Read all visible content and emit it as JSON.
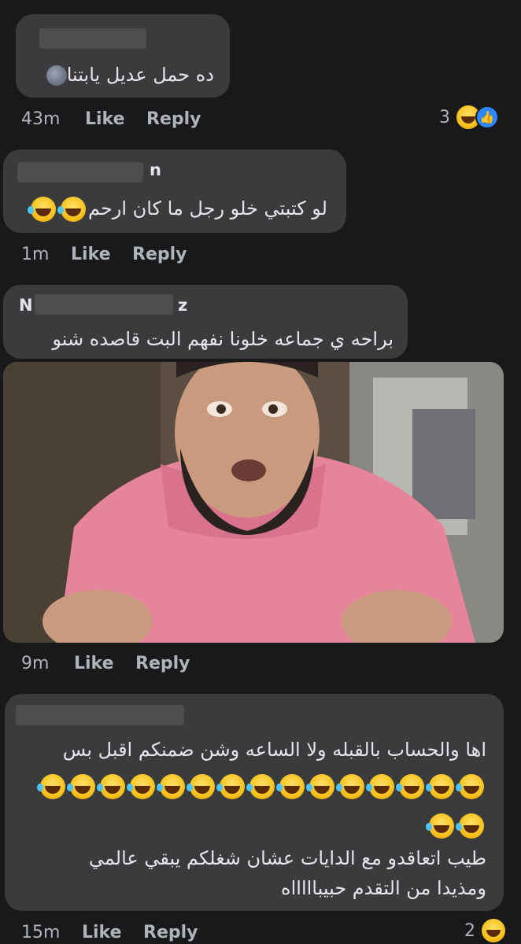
{
  "comments": [
    {
      "name_visible": "",
      "text": "ده حمل عديل يابتنا",
      "time": "43m",
      "like": "Like",
      "reply": "Reply",
      "reaction_count": "3"
    },
    {
      "name_visible": "n",
      "text": "لو كتبتي خلو رجل ما كان ارحم",
      "time": "1m",
      "like": "Like",
      "reply": "Reply"
    },
    {
      "name_visible_start": "N",
      "name_visible_end": "z",
      "text": "براحه ي جماعه خلونا نفهم البت قاصده شنو",
      "time": "9m",
      "like": "Like",
      "reply": "Reply"
    },
    {
      "name_visible": "",
      "text_line1": "اها والحساب بالقبله ولا الساعه وشن ضمنكم اقبل بس",
      "text_line4": "طيب اتعاقدو مع الدايات عشان شغلكم يبقي عالمي",
      "text_line5": "ومذيدا من التقدم حبيباااااه",
      "time": "15m",
      "like": "Like",
      "reply": "Reply",
      "reaction_count": "2"
    }
  ],
  "icons": {
    "moon": "new-moon-face-emoji",
    "laugh": "rolling-on-floor-laughing-emoji",
    "haha_reaction": "haha-reaction-icon",
    "like_reaction": "like-reaction-icon"
  },
  "colors": {
    "background": "#18191a",
    "bubble": "#3a3b3c",
    "text": "#e4e6eb",
    "meta": "#b0b3b8",
    "like_blue": "#2d88ff",
    "shirt_pink": "#e6849c"
  }
}
